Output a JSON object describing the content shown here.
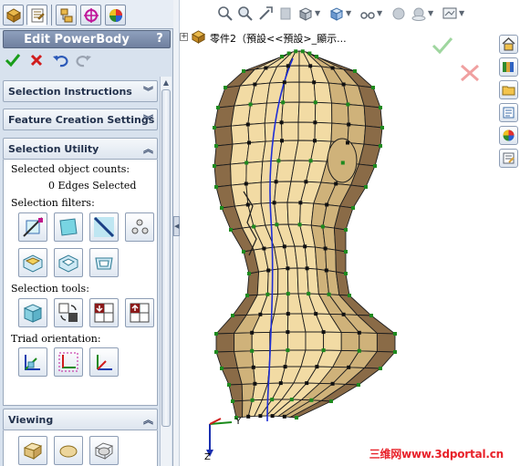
{
  "panel": {
    "title": "Edit PowerBody",
    "help_label": "?",
    "groups": {
      "selection_instructions": "Selection Instructions",
      "feature_creation_settings": "Feature Creation Settings",
      "selection_utility": "Selection Utility",
      "viewing": "Viewing"
    },
    "selection_utility": {
      "counts_label": "Selected object counts:",
      "edges_selected": "0 Edges Selected",
      "filters_label": "Selection filters:",
      "tools_label": "Selection tools:",
      "triad_label": "Triad orientation:"
    }
  },
  "tree": {
    "part_name": "零件2（預設<<預設>_顯示..."
  },
  "triad": {
    "y": "Y",
    "z": "Z"
  },
  "watermark": "三维网www.3dportal.cn",
  "colors": {
    "panel_bg": "#d8e2ee",
    "title_bg": "#7d8eac",
    "mesh_light": "#f2dba4",
    "mesh_mid": "#cfb27a",
    "mesh_dark": "#8a6b47",
    "edge_blue": "#1f2fd6",
    "vertex_green": "#1e8a1e",
    "ok_green": "#1a9d1a",
    "cancel_red": "#d01d1d",
    "watermark_red": "#e8222a"
  },
  "icons": {
    "tabs": [
      "feature-manager-icon",
      "property-manager-icon",
      "configuration-manager-icon",
      "dimxpert-icon",
      "display-manager-icon"
    ],
    "hud": [
      "zoom-to-fit-icon",
      "zoom-to-area-icon",
      "previous-view-icon",
      "section-view-icon",
      "view-orientation-icon",
      "display-style-icon",
      "hide-show-items-icon",
      "edit-appearance-icon",
      "apply-scene-icon",
      "view-settings-icon"
    ],
    "task_pane": [
      "home-icon",
      "design-library-icon",
      "file-explorer-icon",
      "view-palette-icon",
      "appearances-icon",
      "custom-properties-icon"
    ]
  }
}
